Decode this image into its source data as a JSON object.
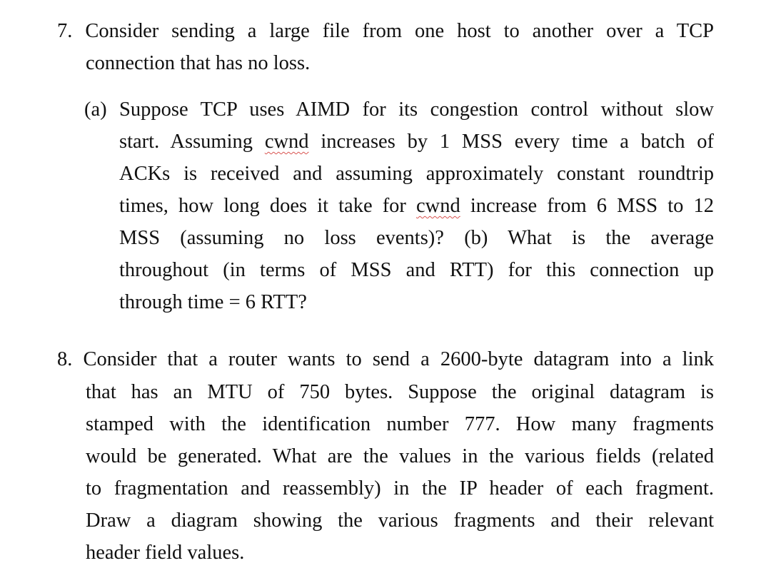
{
  "question7": {
    "number": "7.",
    "lines": [
      "Consider sending a large file from one host to another over a TCP",
      "connection that has no loss."
    ],
    "part_a": {
      "lines": [
        "(a) Suppose TCP uses AIMD for its congestion control without slow",
        "start. Assuming ",
        " increases by 1 MSS every time a batch of",
        "ACKs is received and assuming approximately constant roundtrip",
        "times, how long does it take for ",
        " increase from 6 MSS to 12",
        "MSS (assuming no loss events)?  (b) What is the average",
        "throughout (in terms of MSS and RTT) for this connection up",
        "through time = 6 RTT?"
      ],
      "flagged_word": "cwnd"
    }
  },
  "question8": {
    "number": "8.",
    "lines": [
      "Consider that a router wants to send a 2600-byte datagram into a link",
      "that has an MTU of 750 bytes. Suppose the original datagram is",
      "stamped with the identification number 777. How many fragments",
      "would be generated. What are the values in the various fields (related",
      "to fragmentation and reassembly) in the IP header of each fragment.",
      "Draw a diagram showing the various fragments and their relevant",
      "header field values."
    ]
  },
  "colors": {
    "text": "#111111",
    "spellcheck_underline": "#d9534f",
    "background": "#ffffff"
  }
}
